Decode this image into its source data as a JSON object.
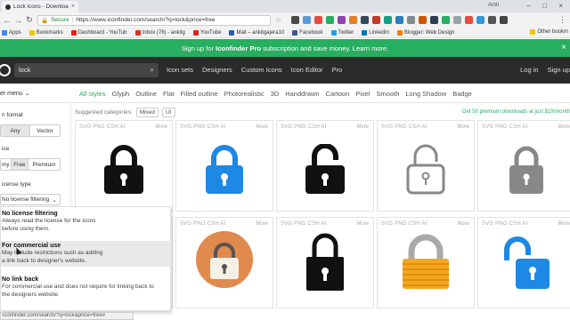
{
  "browser": {
    "tab_title": "Lock icons - Download fr",
    "user": "Antti",
    "secure_label": "Secure",
    "url": "https://www.iconfinder.com/search/?q=lock&price=free",
    "bookmarks": [
      "Apps",
      "Bookmarks",
      "Dashboard - YouTub",
      "Inbox (76) - ankitg",
      "YouTube",
      "Mail – ankitgajera10",
      "Facebook",
      "Twitter",
      "LinkedIn",
      "Blogger: Web Design"
    ],
    "other_bookmarks": "Other bookm",
    "status_url": "iconfinder.com/search/?q=lock&price=free#"
  },
  "promo": {
    "prefix": "Sign up for ",
    "bold": "Iconfinder Pro",
    "suffix": " subscription and save money. Learn more."
  },
  "header": {
    "search_value": "lock",
    "nav": [
      "Icon sets",
      "Designers",
      "Custom Icons",
      "Icon Editor",
      "Pro"
    ],
    "login": "Log in",
    "signup": "Sign up"
  },
  "styles": {
    "filter_menu": "er menu",
    "tabs": [
      "All styles",
      "Glyph",
      "Outline",
      "Flat",
      "Filled outline",
      "Photorealistic",
      "3D",
      "Handdrawn",
      "Cartoon",
      "Pixel",
      "Smooth",
      "Long Shadow",
      "Badge"
    ]
  },
  "sidebar": {
    "format_label": "n format",
    "format_options": [
      "Any",
      "Vector"
    ],
    "price_label": "ice",
    "price_options": [
      "my",
      "Free",
      "Premium"
    ],
    "license_label": "icense type",
    "license_value": "No license filtering"
  },
  "license_dropdown": [
    {
      "title": "No license filtering",
      "desc": [
        "Always read the license for the icons",
        "before using them."
      ]
    },
    {
      "title": "For commercial use",
      "desc": [
        "May include restrictions such as adding",
        "a link back to designer's website."
      ]
    },
    {
      "title": "No link back",
      "desc": [
        "For commercial use and does not require for linking back to",
        "the designers website."
      ]
    }
  ],
  "content": {
    "suggested_label": "Suggested categories:",
    "suggested": [
      "Mixed",
      "UI"
    ],
    "premium_note": "Get 50 premium downloads at just $19/month",
    "card_formats": "SVG  PNG  CSH  AI",
    "more_label": "More",
    "icons": [
      {
        "style": "black-closed"
      },
      {
        "style": "blue-closed"
      },
      {
        "style": "black-open"
      },
      {
        "style": "outline-open"
      },
      {
        "style": "gray-closed"
      },
      {
        "style": "orange-circle"
      },
      {
        "style": "black-tall"
      },
      {
        "style": "orange-3d"
      },
      {
        "style": "blue-open"
      }
    ]
  },
  "colors": {
    "brand_green": "#27ae60",
    "header_dark": "#2b2b2b",
    "lock_blue": "#1e88e5",
    "lock_orange": "#f5a623"
  }
}
